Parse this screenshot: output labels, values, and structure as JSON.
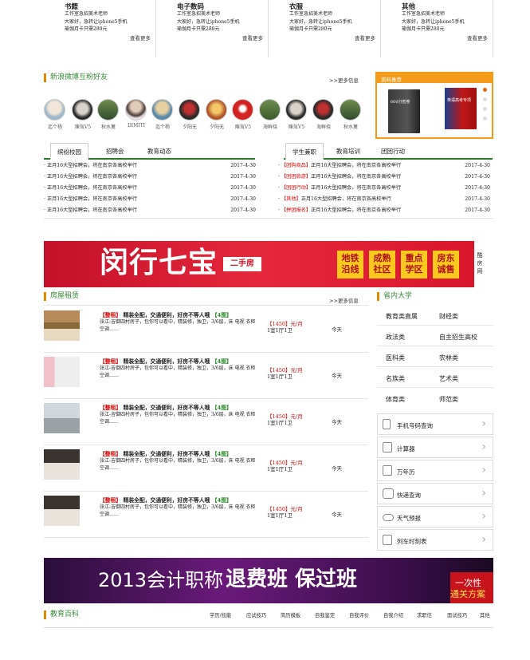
{
  "categories": [
    {
      "title": "书籍",
      "lines": [
        "工作室急招美术老师",
        "大家好，急转让iphone5手机",
        "瑜伽月卡只需280元"
      ],
      "more": "查看更多"
    },
    {
      "title": "电子数码",
      "lines": [
        "工作室急招美术老师",
        "大家好，急转让iphone5手机",
        "瑜伽月卡只需280元"
      ],
      "more": "查看更多"
    },
    {
      "title": "衣服",
      "lines": [
        "工作室急招美术老师",
        "大家好，急转让iphone5手机",
        "瑜伽月卡只需280元"
      ],
      "more": "查看更多"
    },
    {
      "title": "其他",
      "lines": [
        "工作室急招美术老师",
        "大家好，急转让iphone5手机",
        "瑜伽月卡只需280元"
      ],
      "more": "查看更多"
    }
  ],
  "weibo": {
    "title": "新浪微博互粉好友",
    "more": ">>更多信息",
    "friends": [
      "迄个杨",
      "陳氚V5",
      "秋水蓠",
      "DIMITI",
      "迄个杨",
      "夕阳无",
      "夕阳无",
      "陳氚V5",
      "海鲜挠",
      "陳氚V5",
      "海鲜挠",
      "秋水蓠"
    ]
  },
  "recommend": {
    "title": "资料推荐",
    "book1": "600分密卷",
    "book2": "英语高考专项"
  },
  "left_tabs": [
    "缤纷校园",
    "招聘会",
    "教育动态"
  ],
  "right_tabs": [
    "学生兼职",
    "教育培训",
    "团团行动"
  ],
  "left_news": [
    {
      "text": "正月16大型招聘会，将在南京各高校举行",
      "date": "2017-4-30"
    },
    {
      "text": "正月16大型招聘会，将在南京各高校举行",
      "date": "2017-4-30"
    },
    {
      "text": "正月16大型招聘会，将在南京各高校举行",
      "date": "2017-4-30"
    },
    {
      "text": "正月16大型招聘会，将在南京各高校举行",
      "date": "2017-4-30"
    },
    {
      "text": "正月16大型招聘会，将在南京各高校举行",
      "date": "2017-4-30"
    }
  ],
  "right_news": [
    {
      "tag": "【团购商品】",
      "text": "正月16大型招聘会，将在南京各高校举行",
      "date": "2017-4-30"
    },
    {
      "tag": "【团团旅游】",
      "text": "正月16大型招聘会，将在南京各高校举行",
      "date": "2017-4-30"
    },
    {
      "tag": "【团团行动】",
      "text": "正月16大型招聘会，将在南京各高校举行",
      "date": "2017-4-30"
    },
    {
      "tag": "【其他】",
      "text": "正月16大型招聘会，将在南京各高校举行",
      "date": "2017-4-30"
    },
    {
      "tag": "【拼团报名】",
      "text": "正月16大型招聘会，将在南京各高校举行",
      "date": "2017-4-30"
    }
  ],
  "banner1": {
    "main": "闵行七宝",
    "sub": "二手房",
    "tags": [
      "地铁沿线",
      "成熟社区",
      "重点学区",
      "房东诚售"
    ],
    "side": "酷房网"
  },
  "rental": {
    "title": "房屋租赁",
    "more": ">>更多信息",
    "items": [
      {
        "tag": "【整租】",
        "title": "精装全配，交通便利，好房不等人哦",
        "rooms": "【4图】",
        "desc": "张江-吉御四村房子，包你可以看中，精装修，独卫，3/6层，床 电视 衣柜 空调……",
        "price": "【1450】元/月",
        "layout": "1室1厅1卫",
        "date": "今天"
      },
      {
        "tag": "【整租】",
        "title": "精装全配，交通便利，好房不等人哦",
        "rooms": "【4图】",
        "desc": "张江-吉御四村房子，包你可以看中，精装修，独卫，3/6层，床 电视 衣柜 空调……",
        "price": "【1450】元/月",
        "layout": "1室1厅1卫",
        "date": "今天"
      },
      {
        "tag": "【整租】",
        "title": "精装全配，交通便利，好房不等人哦",
        "rooms": "【4图】",
        "desc": "张江-吉御四村房子，包你可以看中，精装修，独卫，3/6层，床 电视 衣柜 空调……",
        "price": "【1450】元/月",
        "layout": "1室1厅1卫",
        "date": "今天"
      },
      {
        "tag": "【整租】",
        "title": "精装全配，交通便利，好房不等人哦",
        "rooms": "【4图】",
        "desc": "张江-吉御四村房子，包你可以看中，精装修，独卫，3/6层，床 电视 衣柜 空调……",
        "price": "【1450】元/月",
        "layout": "1室1厅1卫",
        "date": "今天"
      },
      {
        "tag": "【整租】",
        "title": "精装全配，交通便利，好房不等人哦",
        "rooms": "【4图】",
        "desc": "张江-吉御四村房子，包你可以看中，精装修，独卫，3/6层，床 电视 衣柜 空调……",
        "price": "【1450】元/月",
        "layout": "1室1厅1卫",
        "date": "今天"
      }
    ]
  },
  "university": {
    "title": "省内大学",
    "rows": [
      [
        "教育类直属",
        "财经类"
      ],
      [
        "政法类",
        "自主招生高校"
      ],
      [
        "医科类",
        "农林类"
      ],
      [
        "名族类",
        "艺术类"
      ],
      [
        "体育类",
        "师范类"
      ]
    ]
  },
  "tools": [
    "手机号码查询",
    "计算器",
    "万年历",
    "快递查询",
    "天气预报",
    "列车时刻表"
  ],
  "banner2": {
    "main": "2013会计职称",
    "hl": "退费班 保过班",
    "side1": "一次性",
    "side2": "通关方案"
  },
  "wiki": {
    "title": "教育百科",
    "links": [
      "学历/技能",
      "应试技巧",
      "简历模板",
      "自我鉴定",
      "自我评价",
      "自我介绍",
      "求职信",
      "面试技巧",
      "其他"
    ]
  }
}
